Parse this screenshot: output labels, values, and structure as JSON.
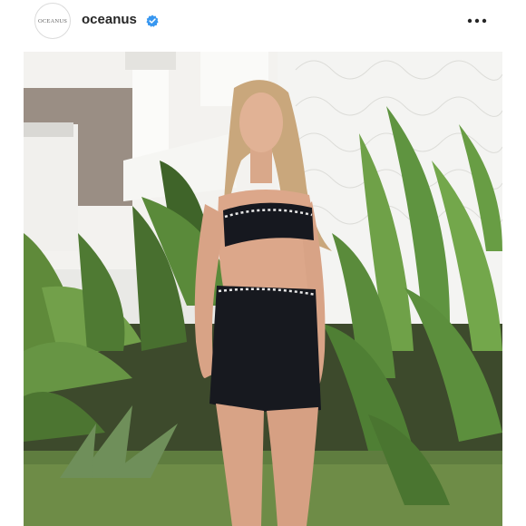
{
  "post": {
    "username": "oceanus",
    "avatar_text": "OCEANUS",
    "verified": true,
    "verified_icon": "verified-badge-icon",
    "more_icon": "more-options-icon"
  },
  "colors": {
    "verified_blue": "#3897f0",
    "text": "#262626"
  }
}
